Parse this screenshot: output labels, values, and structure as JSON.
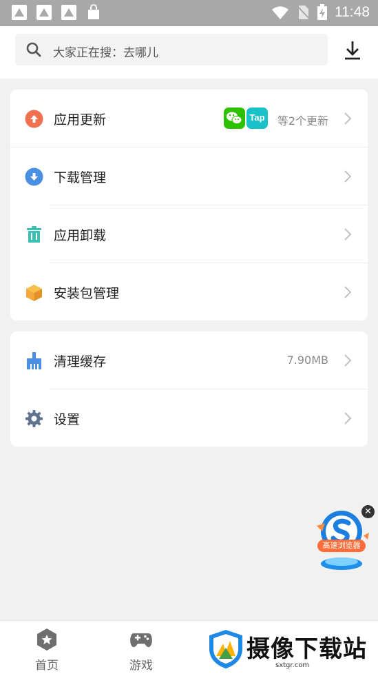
{
  "status_bar": {
    "time": "11:48"
  },
  "header": {
    "search_placeholder": "大家正在搜：去哪儿"
  },
  "menu_group_1": [
    {
      "label": "应用更新",
      "info": "等2个更新",
      "icon": "upload-arrow-icon",
      "color": "#f0714f"
    },
    {
      "label": "下载管理",
      "info": "",
      "icon": "download-arrow-icon",
      "color": "#4a90e2"
    },
    {
      "label": "应用卸载",
      "info": "",
      "icon": "trash-icon",
      "color": "#3dbfb1"
    },
    {
      "label": "安装包管理",
      "info": "",
      "icon": "package-box-icon",
      "color": "#f3a93a"
    }
  ],
  "update_apps": [
    {
      "name": "wechat",
      "color": "#2dc100"
    },
    {
      "name": "taptap",
      "label": "Tap",
      "color": "#19c2c8"
    }
  ],
  "menu_group_2": [
    {
      "label": "清理缓存",
      "info": "7.90MB",
      "icon": "broom-icon",
      "color": "#4a90e2"
    },
    {
      "label": "设置",
      "info": "",
      "icon": "gear-icon",
      "color": "#5f7391"
    }
  ],
  "floating_ad": {
    "label": "高速浏览器"
  },
  "bottom_nav": [
    {
      "label": "首页",
      "icon": "home-star-icon"
    },
    {
      "label": "游戏",
      "icon": "gamepad-icon"
    }
  ],
  "watermark": {
    "text": "摄像下载站",
    "url": "sxtgr.com"
  }
}
